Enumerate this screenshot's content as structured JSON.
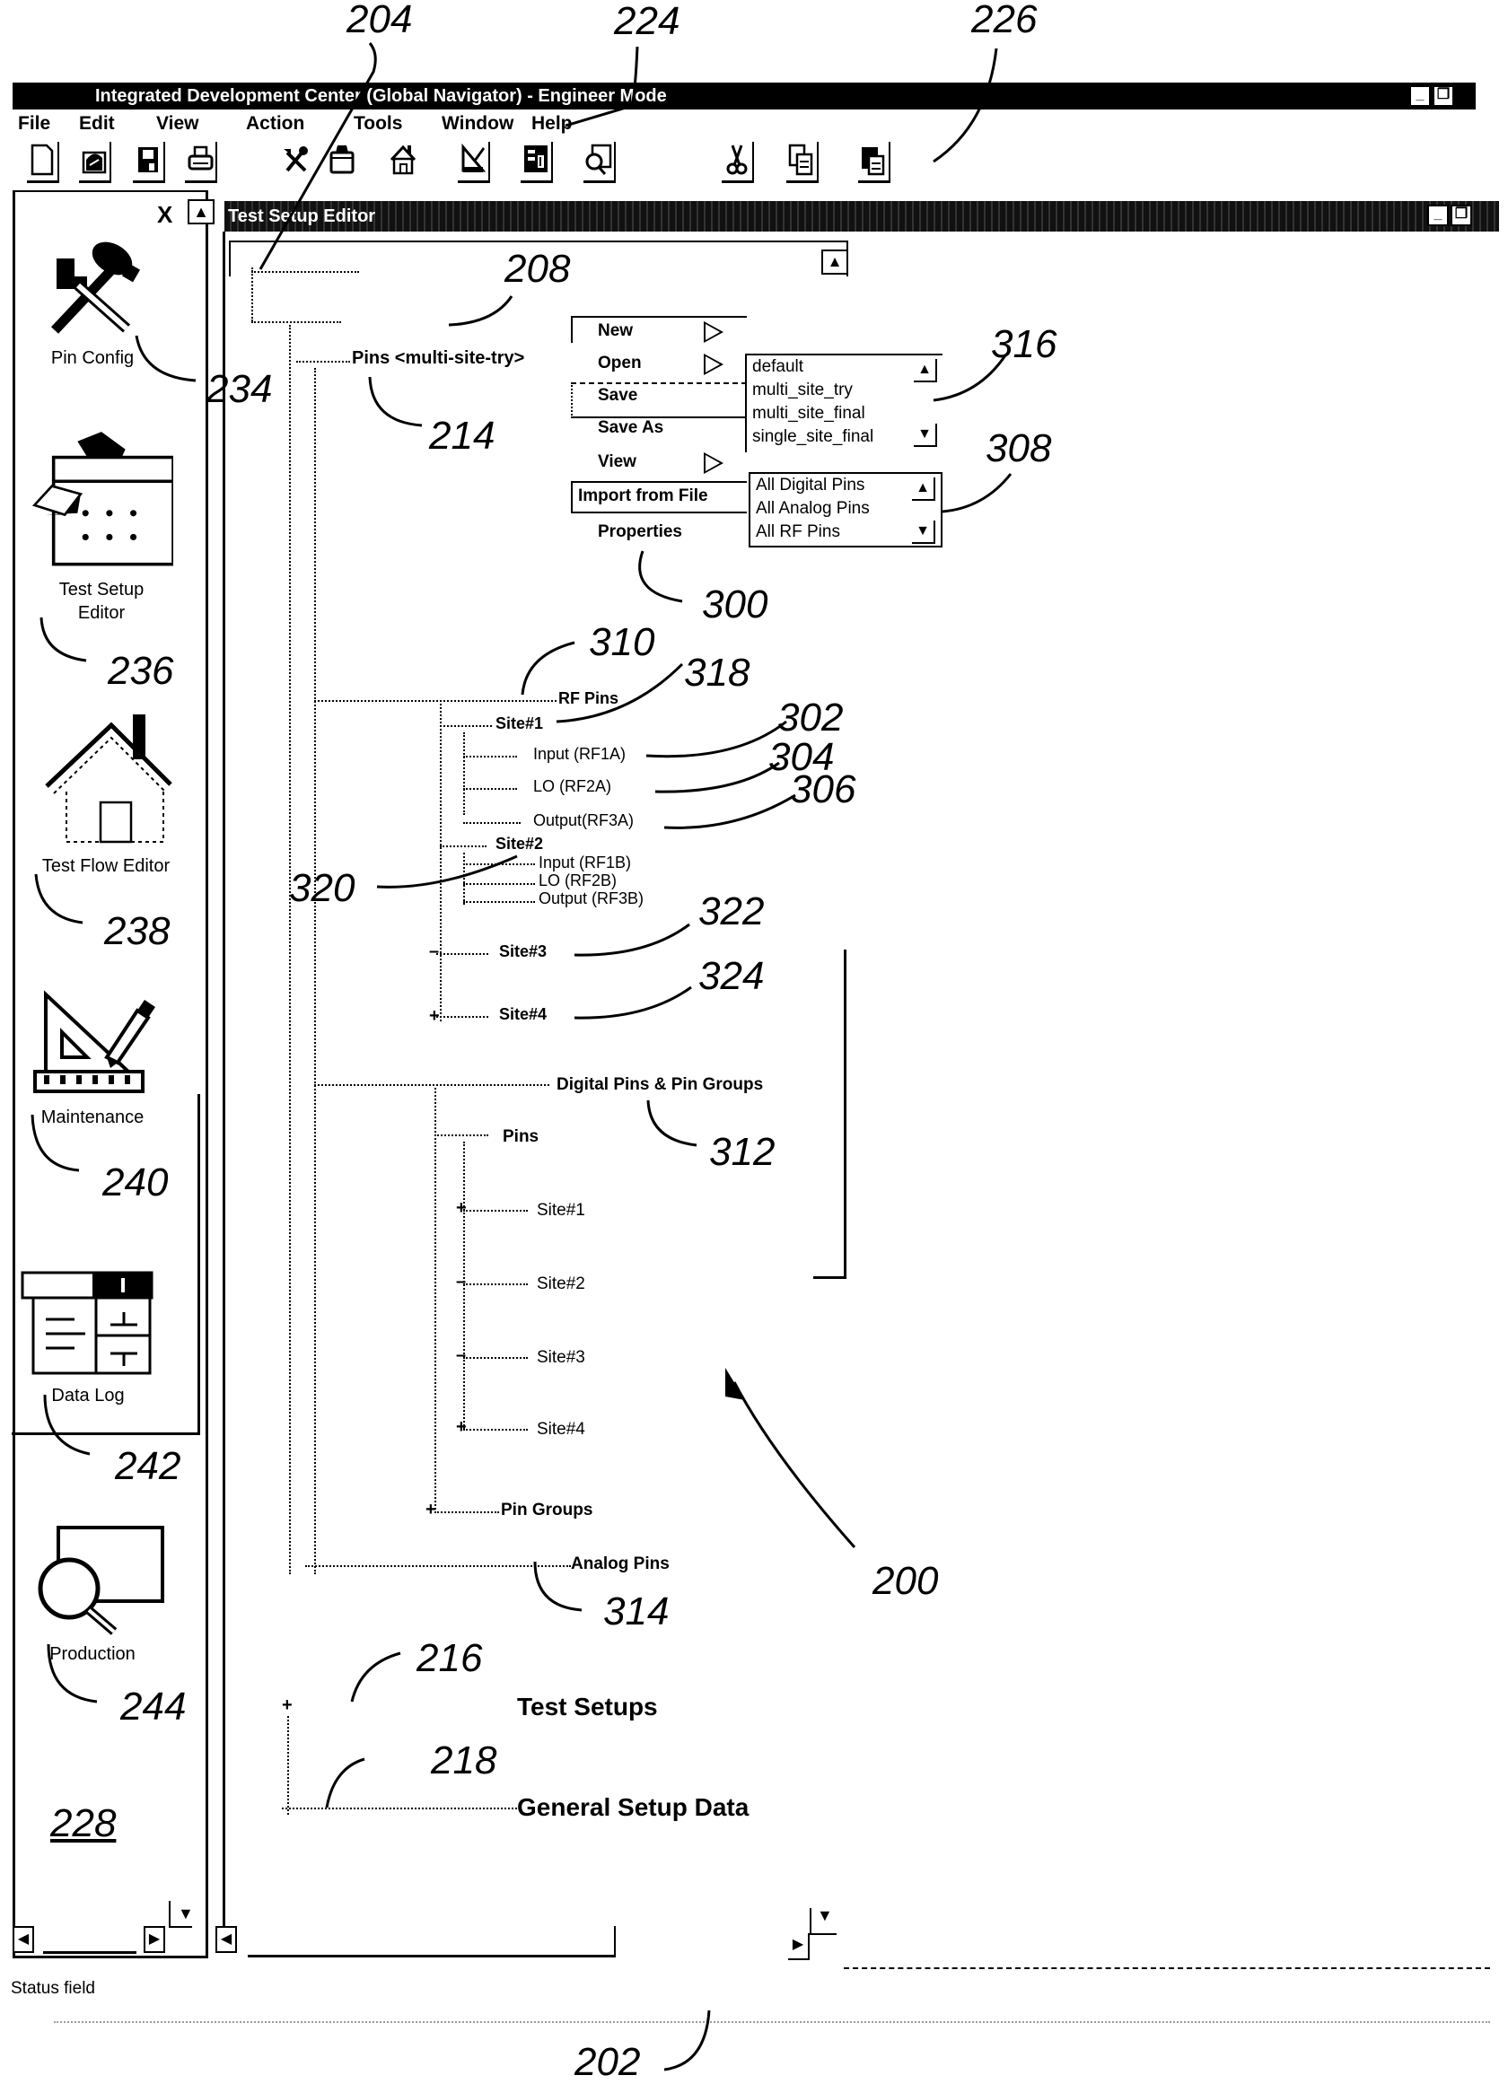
{
  "window": {
    "title": "Integrated  Development Center (Global Navigator) - Engineer Mode",
    "minimize_glyph": "_",
    "restore_glyph": "❐"
  },
  "menubar": {
    "items": [
      "File",
      "Edit",
      "View",
      "Action",
      "Tools",
      "Window",
      "Help"
    ]
  },
  "toolbar": {
    "buttons": [
      {
        "icon": "new-document-icon"
      },
      {
        "icon": "open-folder-icon"
      },
      {
        "icon": "save-disk-icon"
      },
      {
        "icon": "print-icon"
      },
      {
        "icon": "pin-config-tools-icon"
      },
      {
        "icon": "test-setup-icon"
      },
      {
        "icon": "test-flow-house-icon"
      },
      {
        "icon": "maintenance-icon"
      },
      {
        "icon": "data-log-icon"
      },
      {
        "icon": "production-magnifier-icon"
      },
      {
        "icon": "cut-icon"
      },
      {
        "icon": "copy-icon"
      },
      {
        "icon": "paste-icon"
      }
    ]
  },
  "navigator": {
    "close_glyph": "X",
    "scroll_up_glyph": "▲",
    "items": [
      {
        "label": "Pin Config",
        "icon": "pin-config-icon"
      },
      {
        "label_line1": "Test Setup",
        "label_line2": "Editor",
        "icon": "test-setup-editor-icon"
      },
      {
        "label": "Test Flow Editor",
        "icon": "test-flow-editor-icon"
      },
      {
        "label": "Maintenance",
        "icon": "maintenance-icon"
      },
      {
        "label": "Data Log",
        "icon": "data-log-icon"
      },
      {
        "label": "Production",
        "icon": "production-icon"
      }
    ]
  },
  "editor": {
    "title": "Test Setup Editor",
    "scroll_up_glyph": "▲",
    "tree": {
      "pins_root": "Pins <multi-site-try>",
      "rf_pins": "RF Pins",
      "rf_site1": "Site#1",
      "rf_site1_children": [
        "Input (RF1A)",
        "LO (RF2A)",
        "Output(RF3A)"
      ],
      "rf_site2": "Site#2",
      "rf_site2_children": [
        "Input (RF1B)",
        "LO (RF2B)",
        "Output (RF3B)"
      ],
      "rf_site3": "Site#3",
      "rf_site4": "Site#4",
      "digital": "Digital Pins & Pin Groups",
      "digital_pins": "Pins",
      "digital_sites": [
        "Site#1",
        "Site#2",
        "Site#3",
        "Site#4"
      ],
      "pin_groups": "Pin Groups",
      "analog": "Analog Pins",
      "test_setups": "Test Setups",
      "general_setup": "General Setup Data"
    },
    "context_menu": {
      "items": [
        "New",
        "Open",
        "Save",
        "Save As",
        "View",
        "Import from  File",
        "Properties"
      ]
    },
    "open_listbox": {
      "options": [
        "default",
        "multi_site_try",
        "multi_site_final",
        "single_site_final"
      ],
      "up_glyph": "▲",
      "down_glyph": "▼"
    },
    "import_listbox": {
      "options": [
        "All Digital Pins",
        "All Analog Pins",
        "All RF Pins"
      ],
      "up_glyph": "▲",
      "down_glyph": "▼"
    }
  },
  "scrollbars": {
    "left_glyph": "◀",
    "right_glyph": "▶",
    "down_glyph": "▼"
  },
  "status": {
    "label": "Status field"
  },
  "reference_numerals": {
    "r204": "204",
    "r224": "224",
    "r226": "226",
    "r208": "208",
    "r316": "316",
    "r234": "234",
    "r214": "214",
    "r308": "308",
    "r300": "300",
    "r236": "236",
    "r310": "310",
    "r318": "318",
    "r302": "302",
    "r304": "304",
    "r306": "306",
    "r320": "320",
    "r238": "238",
    "r322": "322",
    "r324": "324",
    "r240": "240",
    "r312": "312",
    "r242": "242",
    "r200": "200",
    "r314": "314",
    "r216": "216",
    "r244": "244",
    "r218": "218",
    "r228": "228",
    "r202": "202"
  }
}
